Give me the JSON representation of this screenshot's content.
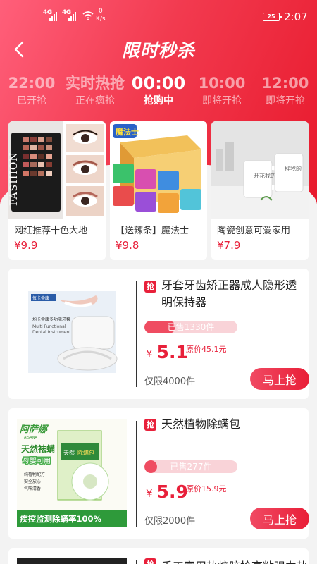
{
  "status_bar": {
    "sim1": "4G",
    "sim2": "4G",
    "speed_value": "0",
    "speed_unit": "K/s",
    "battery": "25",
    "time": "2:07"
  },
  "header": {
    "back_icon": "chevron-left-icon",
    "title": "限时秒杀"
  },
  "time_tabs": [
    {
      "time": "22:00",
      "status": "已开抢"
    },
    {
      "time": "实时热抢",
      "status": "正在疯抢"
    },
    {
      "time": "00:00",
      "status": "抢购中",
      "active": true
    },
    {
      "time": "10:00",
      "status": "即将开抢"
    },
    {
      "time": "12:00",
      "status": "即将开抢"
    }
  ],
  "featured": [
    {
      "name": "网红推荐十色大地",
      "price": "¥9.9",
      "image_text": "FASHION"
    },
    {
      "name": "【送辣条】魔法士",
      "price": "¥9.8",
      "image_text": "魔法士"
    },
    {
      "name": "陶瓷创意可爱家用",
      "price": "¥7.9",
      "image_text_1": "开花我的",
      "image_text_2": "拌我的"
    }
  ],
  "products": [
    {
      "badge": "抢",
      "name": "牙套牙齿矫正器成人隐形透明保持器",
      "sold": "已售1330件",
      "sold_fraction": 0.33,
      "currency": "¥",
      "price": "5.1",
      "original": "原价45.1元",
      "limit": "仅限4000件",
      "buy_label": "马上抢",
      "image_text_1": "每卡金康",
      "image_text_2": "均卡金康多功能牙套",
      "image_text_3": "Multi Functional",
      "image_text_4": "Dental Instrument"
    },
    {
      "badge": "抢",
      "name": "天然植物除螨包",
      "sold": "已售277件",
      "sold_fraction": 0.07,
      "currency": "¥",
      "price": "5.9",
      "original": "原价15.9元",
      "limit": "仅限2000件",
      "buy_label": "马上抢",
      "image_text_1": "阿萨娜",
      "image_text_2": "AISANA",
      "image_text_3": "天然祛螨",
      "image_text_4": "母婴可用",
      "image_text_5": "纯植物配方",
      "image_text_6": "安全放心",
      "image_text_7": "气味清香",
      "image_text_8": "疾控监测除螨率100%",
      "image_text_9": "天然",
      "image_text_10": "除螨包"
    }
  ],
  "teaser": {
    "badge": "抢",
    "name": "手工家用热熔胶枪高粘强力热"
  },
  "colors": {
    "accent": "#e8203a",
    "hero_start": "#ff5f7a",
    "hero_end": "#e8192c"
  }
}
